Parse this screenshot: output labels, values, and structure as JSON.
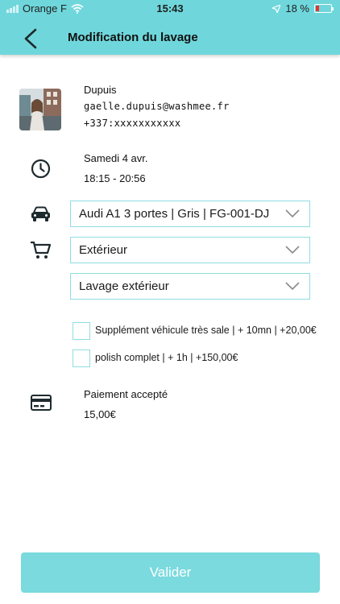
{
  "status_bar": {
    "carrier": "Orange F",
    "time": "15:43",
    "battery": "18 %"
  },
  "header": {
    "title": "Modification du lavage"
  },
  "customer": {
    "name": "Dupuis",
    "email": "gaelle.dupuis@washmee.fr",
    "phone": "+337:xxxxxxxxxxx"
  },
  "schedule": {
    "date": "Samedi 4 avr.",
    "time_range": "18:15 - 20:56"
  },
  "vehicle_select": {
    "value": "Audi A1 3 portes | Gris | FG-001-DJ"
  },
  "service_select": {
    "value": "Extérieur"
  },
  "wash_select": {
    "value": "Lavage extérieur"
  },
  "options": [
    {
      "label": "Supplément véhicule très sale | + 10mn | +20,00€",
      "checked": false
    },
    {
      "label": "polish complet | + 1h | +150,00€",
      "checked": false
    }
  ],
  "payment": {
    "status": "Paiement accepté",
    "amount": "15,00€"
  },
  "actions": {
    "validate_label": "Valider"
  },
  "colors": {
    "accent": "#6fd7dc",
    "border": "#8fdde0",
    "button": "#7adadd"
  }
}
